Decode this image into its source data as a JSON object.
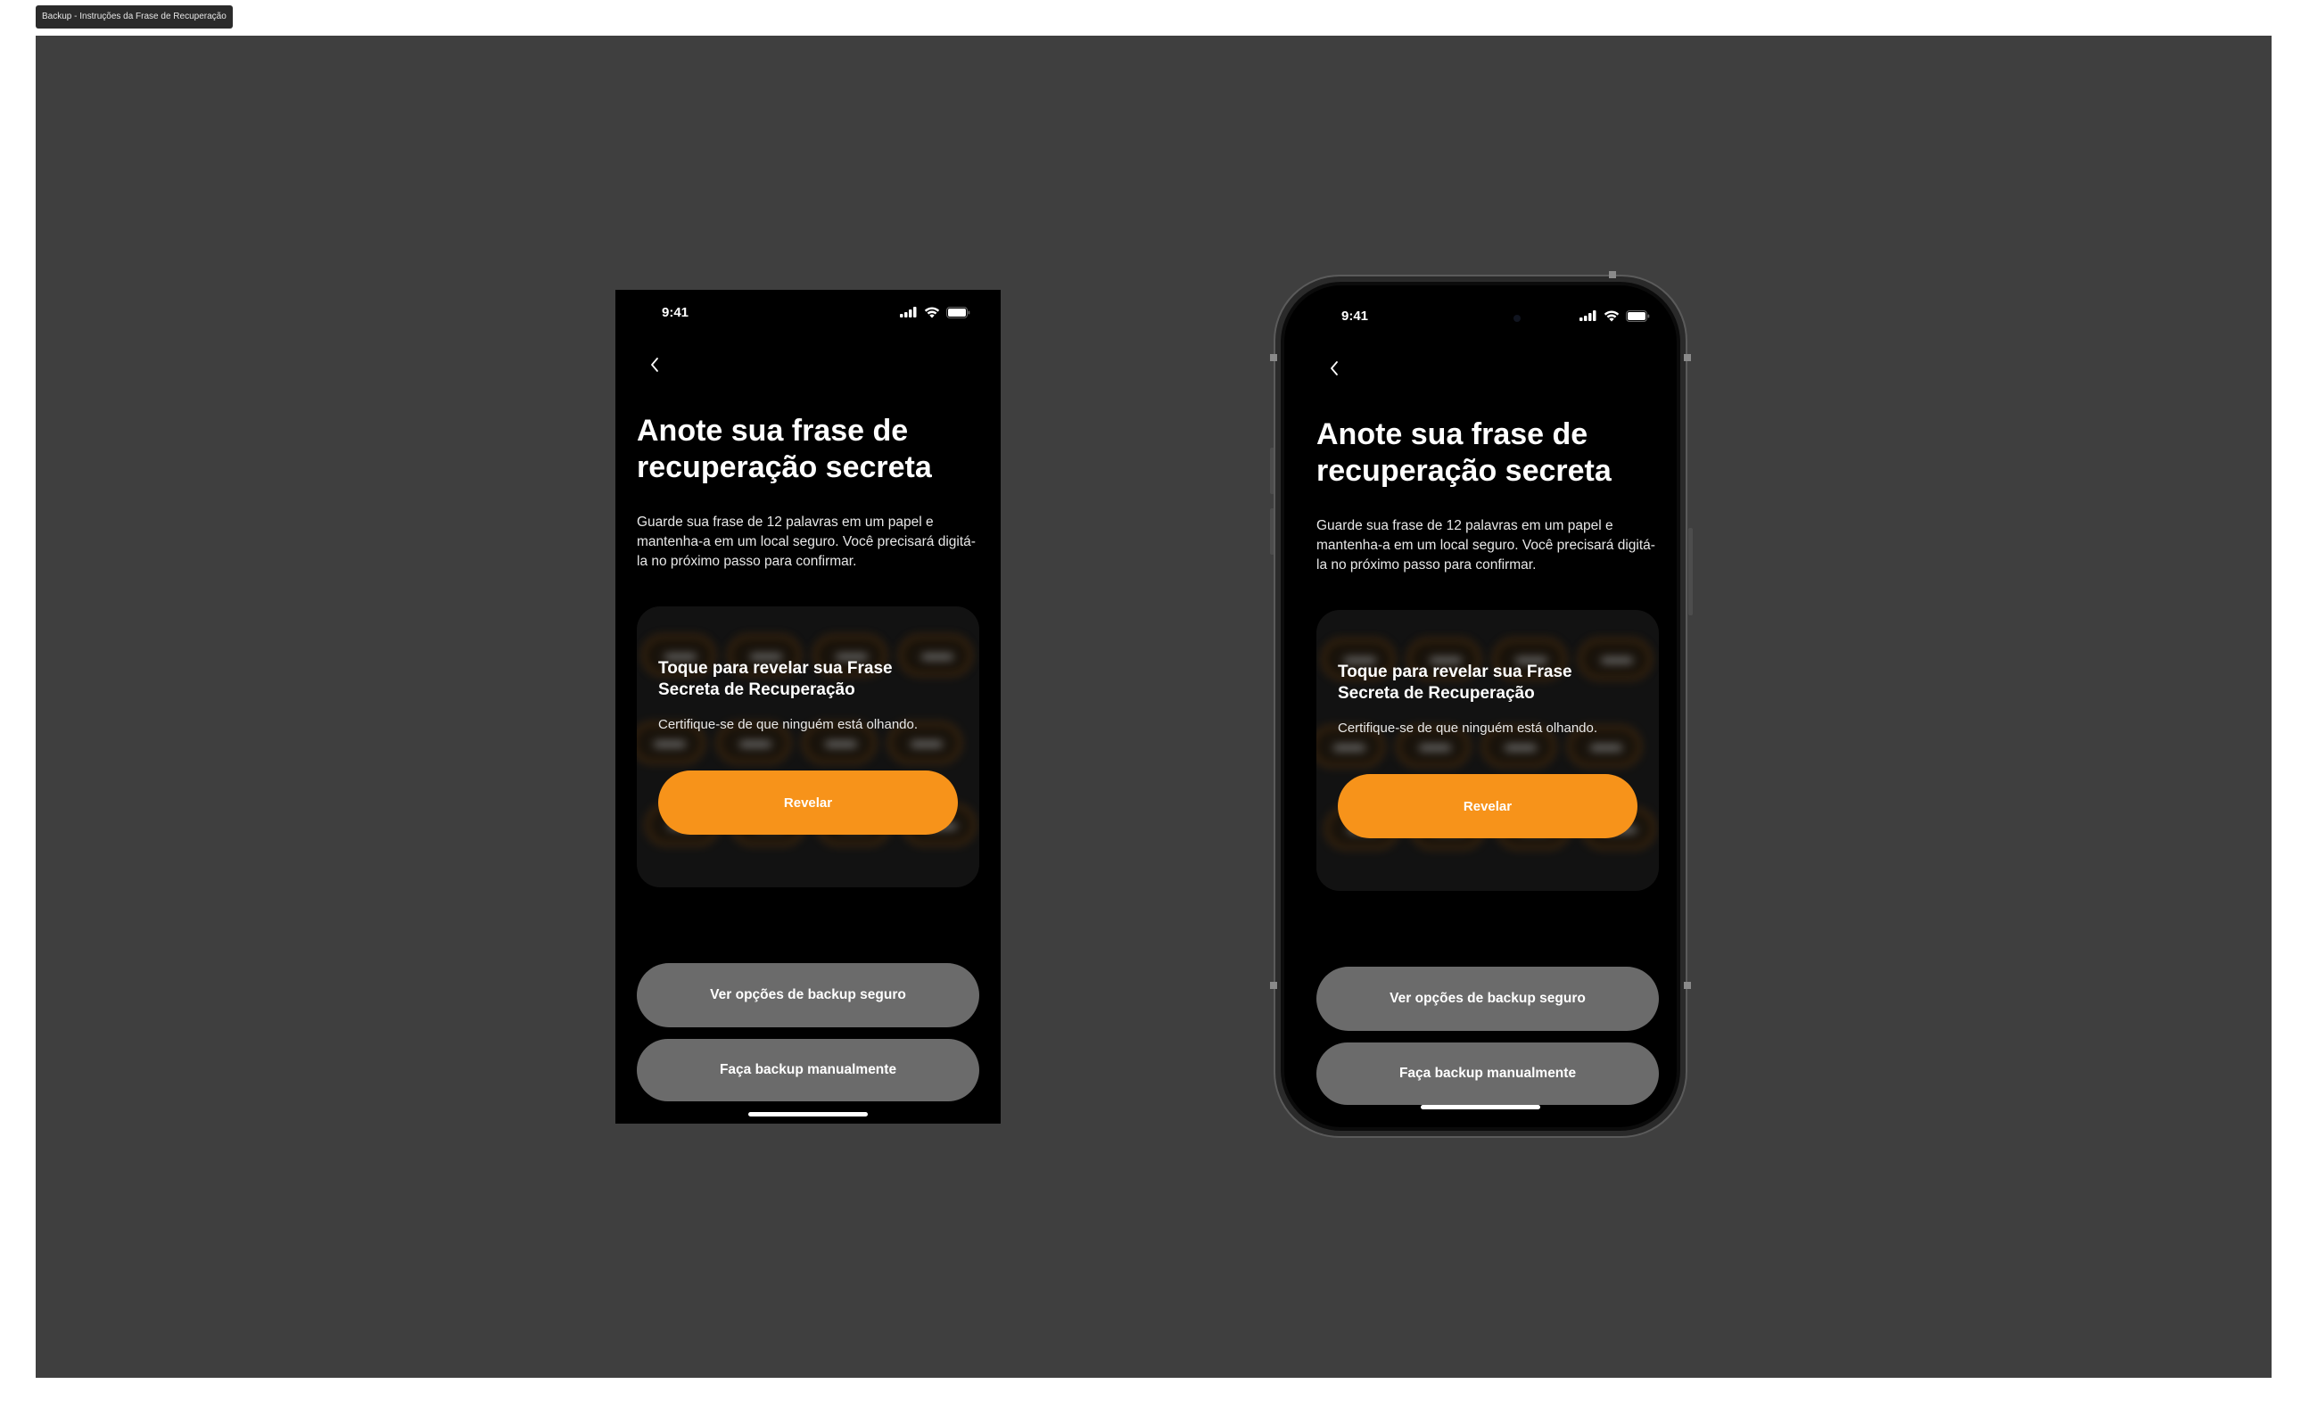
{
  "frame_label": "Backup - Instruções da Frase de Recuperação",
  "colors": {
    "accent": "#f7931a",
    "canvas": "#3f3f3f",
    "secondary_button": "#6b6b6b",
    "screen": "#000000"
  },
  "status_bar": {
    "time": "9:41",
    "icons": [
      "cellular-signal-icon",
      "wifi-icon",
      "battery-icon"
    ]
  },
  "header": {
    "back_icon": "chevron-left-icon"
  },
  "title": "Anote sua frase de recuperação secreta",
  "description": "Guarde sua frase de 12 palavras em um papel e mantenha-a em um local seguro. Você precisará digitá-la no próximo passo para confirmar.",
  "reveal_card": {
    "title": "Toque para revelar sua Frase Secreta de Recuperação",
    "subtitle": "Certifique-se de que ninguém está olhando.",
    "button_label": "Revelar"
  },
  "buttons": {
    "backup_options": "Ver opções de backup seguro",
    "manual_backup": "Faça backup manualmente"
  }
}
